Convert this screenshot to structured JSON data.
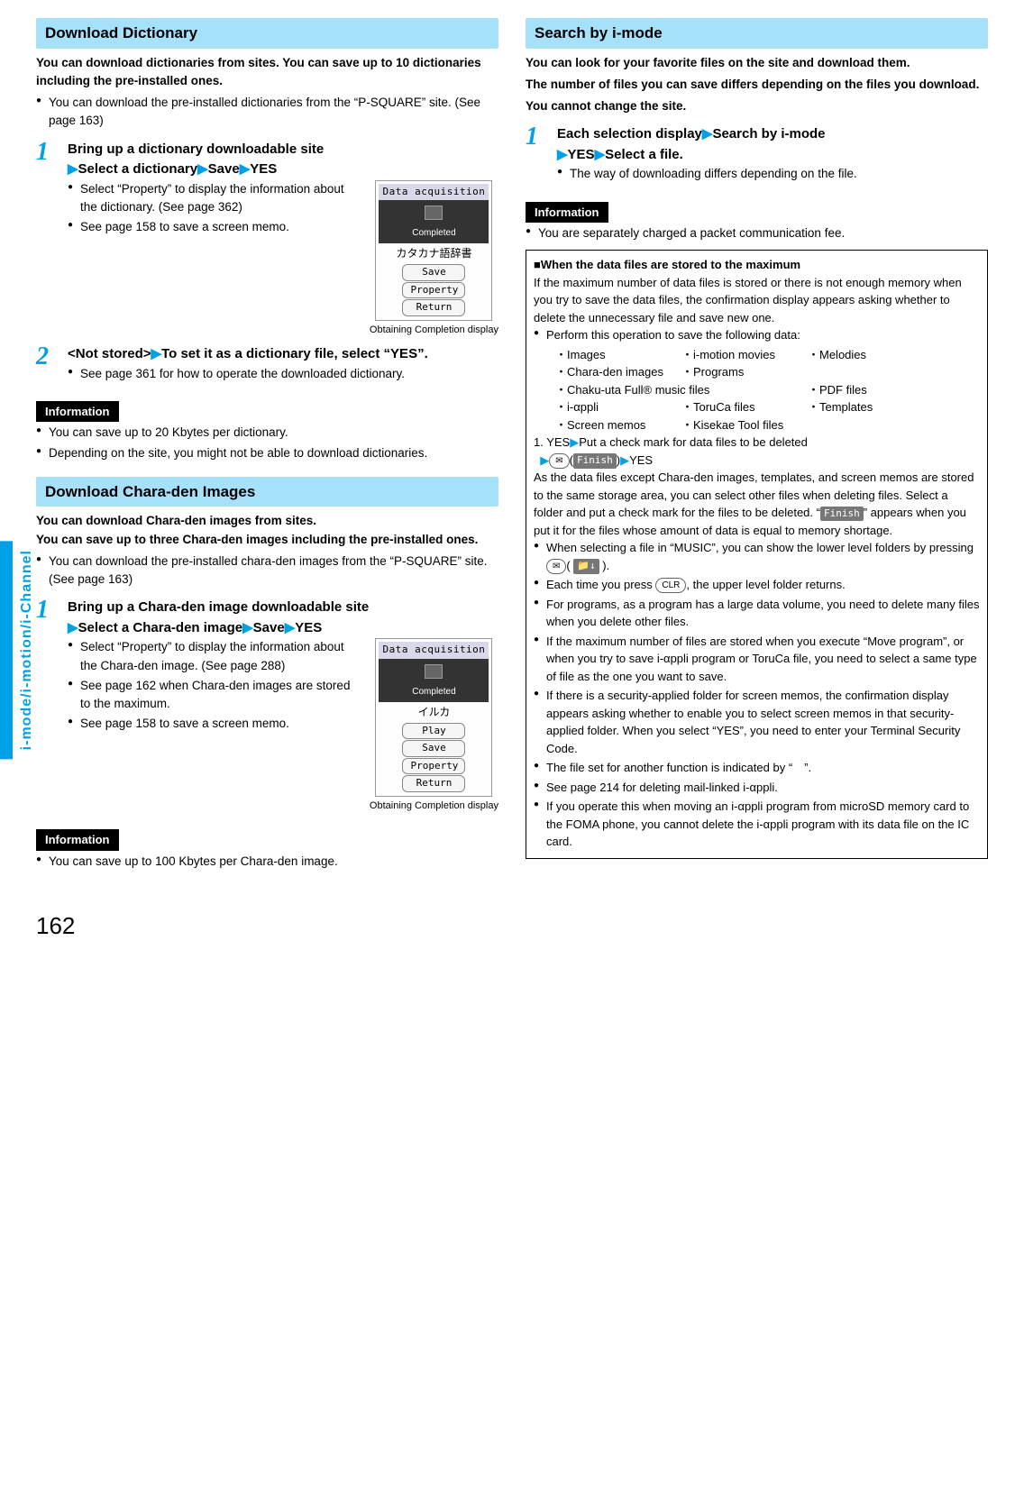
{
  "sideTab": "i-mode/i-motion/i-Channel",
  "pageNumber": "162",
  "left": {
    "sec1": {
      "header": "Download Dictionary",
      "intro": "You can download dictionaries from sites. You can save up to 10 dictionaries including the pre-installed ones.",
      "bullet1": "You can download the pre-installed dictionaries from the “P-SQUARE” site. (See page 163)",
      "step1num": "1",
      "step1a": "Bring up a dictionary downloadable site",
      "step1b": "Select a dictionary",
      "step1c": "Save",
      "step1d": "YES",
      "step1n1": "Select “Property” to display the information about the dictionary. (See page 362)",
      "step1n2": "See page 158 to save a screen memo.",
      "scrTitle": "Data acquisition",
      "scrJp": "カタカナ語辞書",
      "scrBtn1": "Save",
      "scrBtn2": "Property",
      "scrBtn3": "Return",
      "scrCap": "Obtaining Completion display",
      "step2num": "2",
      "step2a": "<Not stored>",
      "step2b": "To set it as a dictionary file, select “YES”.",
      "step2n1": "See page 361 for how to operate the downloaded dictionary.",
      "infoLabel": "Information",
      "info1": "You can save up to 20 Kbytes per dictionary.",
      "info2": "Depending on the site, you might not be able to download dictionaries."
    },
    "sec2": {
      "header": "Download Chara-den Images",
      "intro": "You can download Chara-den images from sites.\nYou can save up to three Chara-den images including the pre-installed ones.",
      "bullet1": "You can download the pre-installed chara-den images from the “P-SQUARE” site. (See page 163)",
      "step1num": "1",
      "step1a": "Bring up a Chara-den image downloadable site",
      "step1b": "Select a Chara-den image",
      "step1c": "Save",
      "step1d": "YES",
      "step1n1": "Select “Property” to display the information about the Chara-den image. (See page 288)",
      "step1n2": "See page 162 when Chara-den images are stored to the maximum.",
      "step1n3": "See page 158 to save a screen memo.",
      "scrTitle": "Data acquisition",
      "scrJp": "イルカ",
      "scrBtn0": "Play",
      "scrBtn1": "Save",
      "scrBtn2": "Property",
      "scrBtn3": "Return",
      "scrCap": "Obtaining Completion display",
      "infoLabel": "Information",
      "info1": "You can save up to 100 Kbytes per Chara-den image."
    }
  },
  "right": {
    "header": "Search by i-mode",
    "intro1": "You can look for your favorite files on the site and download them.",
    "intro2": "The number of files you can save differs depending on the files you download.",
    "intro3": "You cannot change the site.",
    "step1num": "1",
    "step1a": "Each selection display",
    "step1b": "Search by i-mode",
    "step1c": "YES",
    "step1d": "Select a file.",
    "step1n1": "The way of downloading differs depending on the file.",
    "infoLabel": "Information",
    "info1": "You are separately charged a packet communication fee.",
    "box": {
      "title": "When the data files are stored to the maximum",
      "p1": "If the maximum number of data files is stored or there is not enough memory when you try to save the data files, the confirmation display appears asking whether to delete the unnecessary file and save new one.",
      "p2": "Perform this operation to save the following data:",
      "d1a": "・Images",
      "d1b": "・i-motion movies",
      "d1c": "・Melodies",
      "d2a": "・Chara-den images",
      "d2b": "・Programs",
      "d3a": "・Chaku-uta Full® music files",
      "d3b": "・PDF files",
      "d4a": "・i-αppli",
      "d4b": "・ToruCa files",
      "d4c": "・Templates",
      "d5a": "・Screen memos",
      "d5b": "・Kisekae Tool files",
      "seq1a": "1. YES",
      "seq1b": "Put a check mark for data files to be deleted",
      "seqFinish": "Finish",
      "seqYes": "YES",
      "p3": "As the data files except Chara-den images, templates, and screen memos are stored to the same storage area, you can select other files when deleting files. Select a folder and put a check mark for the files to be deleted. “",
      "p3b": "” appears when you put it for the files whose amount of data is equal to memory shortage.",
      "b1a": "When selecting a file in “MUSIC”, you can show the lower level folders by pressing ",
      "b1b": ".",
      "b2a": "Each time you press ",
      "b2clr": "CLR",
      "b2b": ", the upper level folder returns.",
      "b3": "For programs, as a program has a large data volume, you need to delete many files when you delete other files.",
      "b4": "If the maximum number of files are stored when you execute “Move program”, or when you try to save i-αppli program or ToruCa file, you need to select a same type of file as the one you want to save.",
      "b5": "If there is a security-applied folder for screen memos, the confirmation display appears asking whether to enable you to select screen memos in that security-applied folder. When you select “YES”, you need to enter your Terminal Security Code.",
      "b6": "The file set for another function is indicated by “　”.",
      "b7": "See page 214 for deleting mail-linked i-αppli.",
      "b8": "If you operate this when moving an i-αppli program from microSD memory card to the FOMA phone, you cannot delete the i-αppli program with its data file on the IC card."
    }
  }
}
